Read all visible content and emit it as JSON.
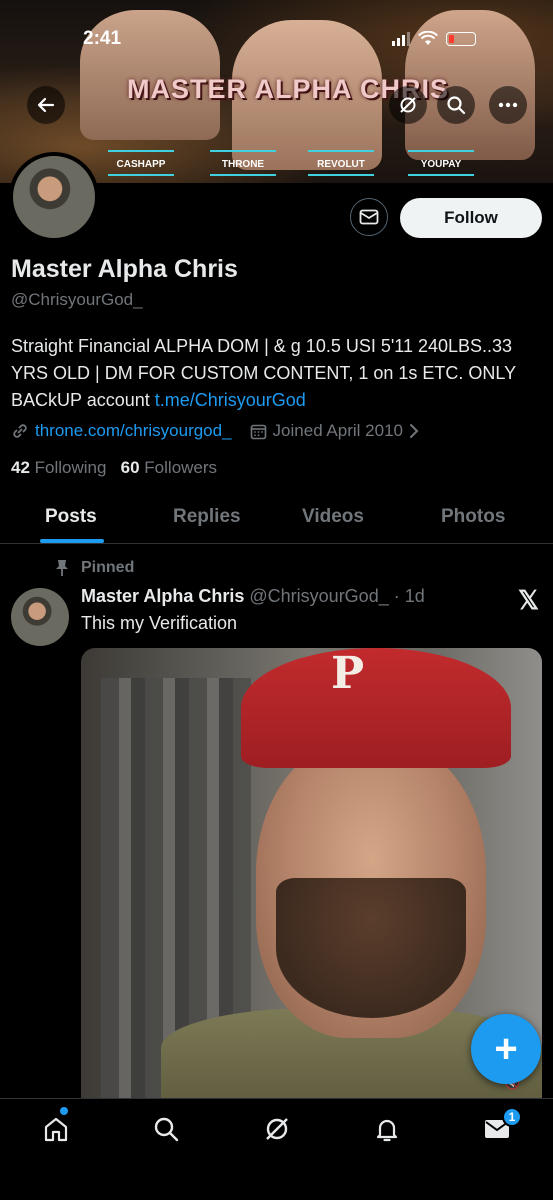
{
  "status_bar": {
    "time": "2:41"
  },
  "banner": {
    "title": "MASTER ALPHA CHRIS",
    "links": [
      "CASHAPP",
      "THRONE",
      "REVOLUT",
      "YOUPAY"
    ]
  },
  "profile": {
    "display_name": "Master Alpha Chris",
    "handle": "@ChrisyourGod_",
    "bio_text": "Straight Financial ALPHA DOM | & g 10.5 USI 5'11 240LBS..33 YRS OLD | DM FOR CUSTOM CONTENT, 1 on 1s ETC. ONLY BACkUP account ",
    "bio_link": "t.me/ChrisyourGod",
    "website": "throne.com/chrisyourgod_",
    "joined": "Joined April 2010",
    "following_count": "42",
    "following_label": "Following",
    "followers_count": "60",
    "followers_label": "Followers",
    "follow_button": "Follow"
  },
  "tabs": [
    "Posts",
    "Replies",
    "Videos",
    "Photos"
  ],
  "post": {
    "pinned_label": "Pinned",
    "author": "Master Alpha Chris",
    "handle_time": "@ChrisyourGod_ · 1d",
    "text": "This my Verification",
    "cap_letter": "P"
  },
  "fab_label": "+",
  "nav": {
    "messages_badge": "1"
  },
  "colors": {
    "accent": "#1d9bf0",
    "background": "#000000",
    "muted": "#71767b"
  }
}
